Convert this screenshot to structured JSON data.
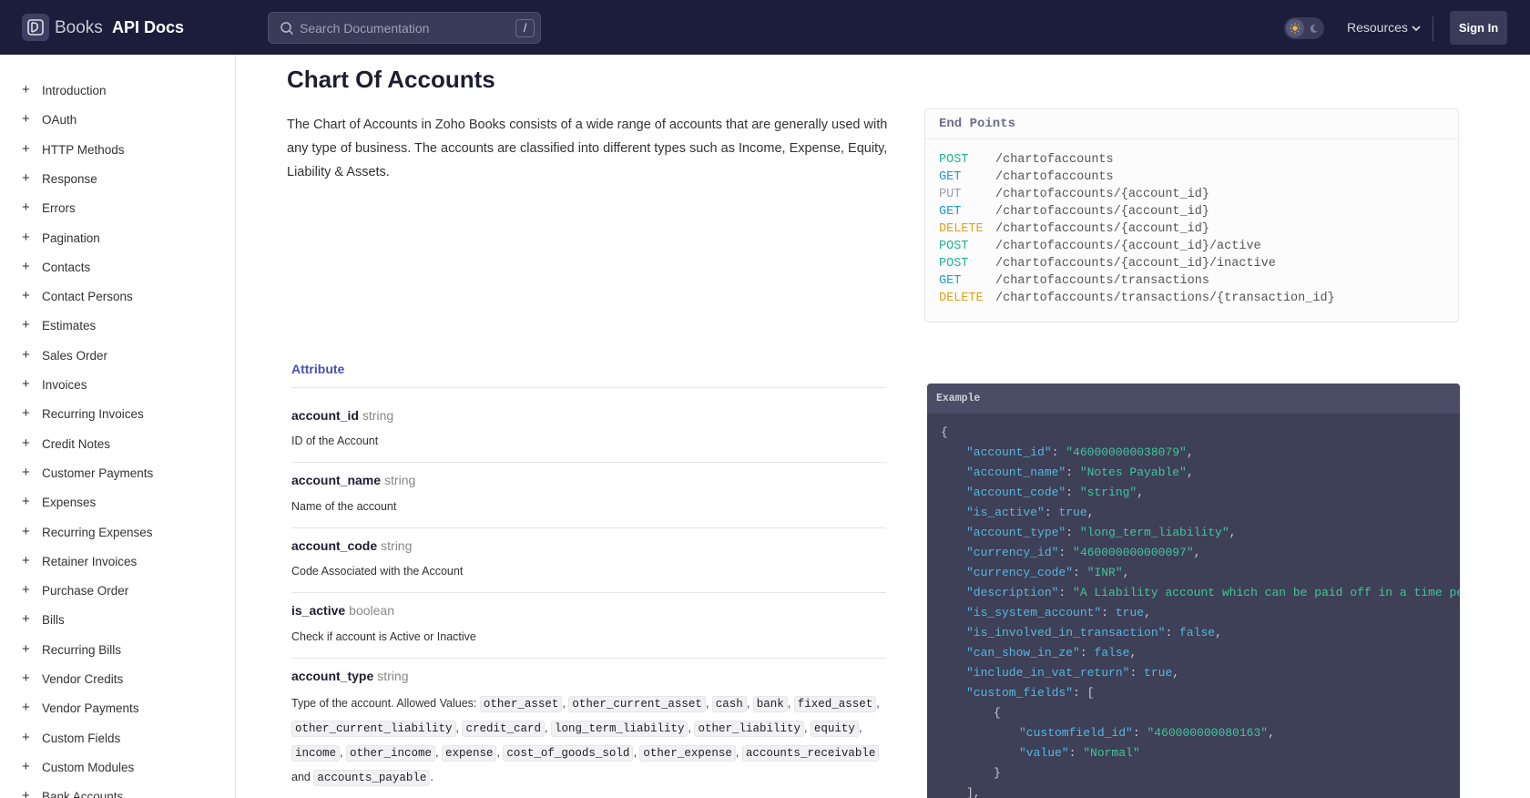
{
  "header": {
    "brand_name": "Books",
    "product_name": "API Docs",
    "search_placeholder": "Search Documentation",
    "search_shortcut": "/",
    "resources_label": "Resources",
    "signin_label": "Sign In"
  },
  "sidebar": {
    "items": [
      {
        "label": "Introduction"
      },
      {
        "label": "OAuth"
      },
      {
        "label": "HTTP Methods"
      },
      {
        "label": "Response"
      },
      {
        "label": "Errors"
      },
      {
        "label": "Pagination"
      },
      {
        "label": "Contacts"
      },
      {
        "label": "Contact Persons"
      },
      {
        "label": "Estimates"
      },
      {
        "label": "Sales Order"
      },
      {
        "label": "Invoices"
      },
      {
        "label": "Recurring Invoices"
      },
      {
        "label": "Credit Notes"
      },
      {
        "label": "Customer Payments"
      },
      {
        "label": "Expenses"
      },
      {
        "label": "Recurring Expenses"
      },
      {
        "label": "Retainer Invoices"
      },
      {
        "label": "Purchase Order"
      },
      {
        "label": "Bills"
      },
      {
        "label": "Recurring Bills"
      },
      {
        "label": "Vendor Credits"
      },
      {
        "label": "Vendor Payments"
      },
      {
        "label": "Custom Fields"
      },
      {
        "label": "Custom Modules"
      },
      {
        "label": "Bank Accounts"
      }
    ],
    "expand_symbol": "+"
  },
  "main": {
    "title": "Chart Of Accounts",
    "intro": "The Chart of Accounts in Zoho Books consists of a wide range of accounts that are generally used with any type of business. The accounts are classified into different types such as Income, Expense, Equity, Liability & Assets."
  },
  "endpoints": {
    "title": "End Points",
    "rows": [
      {
        "method": "POST",
        "path": "/chartofaccounts"
      },
      {
        "method": "GET",
        "path": "/chartofaccounts"
      },
      {
        "method": "PUT",
        "path": "/chartofaccounts/{account_id}"
      },
      {
        "method": "GET",
        "path": "/chartofaccounts/{account_id}"
      },
      {
        "method": "DELETE",
        "path": "/chartofaccounts/{account_id}"
      },
      {
        "method": "POST",
        "path": "/chartofaccounts/{account_id}/active"
      },
      {
        "method": "POST",
        "path": "/chartofaccounts/{account_id}/inactive"
      },
      {
        "method": "GET",
        "path": "/chartofaccounts/transactions"
      },
      {
        "method": "DELETE",
        "path": "/chartofaccounts/transactions/{transaction_id}"
      }
    ],
    "colors": {
      "POST": "#1fb58f",
      "GET": "#1e9ad6",
      "PUT": "#9a9cb0",
      "DELETE": "#e0a21b"
    }
  },
  "attributes": {
    "title": "Attribute",
    "items": [
      {
        "name": "account_id",
        "type": "string",
        "desc": "ID of the Account"
      },
      {
        "name": "account_name",
        "type": "string",
        "desc": "Name of the account"
      },
      {
        "name": "account_code",
        "type": "string",
        "desc": "Code Associated with the Account"
      },
      {
        "name": "is_active",
        "type": "boolean",
        "desc": "Check if account is Active or Inactive"
      },
      {
        "name": "account_type",
        "type": "string",
        "desc": "Type of the account. Allowed Values:"
      }
    ],
    "allowed_values": [
      "other_asset",
      "other_current_asset",
      "cash",
      "bank",
      "fixed_asset",
      "other_current_liability",
      "credit_card",
      "long_term_liability",
      "other_liability",
      "equity",
      "income",
      "other_income",
      "expense",
      "cost_of_goods_sold",
      "other_expense",
      "accounts_receivable",
      "accounts_payable"
    ],
    "and_word": "and"
  },
  "example": {
    "title": "Example",
    "open_brace": "{",
    "lines": [
      {
        "key": "\"account_id\"",
        "val": "\"460000000038079\"",
        "kind": "s"
      },
      {
        "key": "\"account_name\"",
        "val": "\"Notes Payable\"",
        "kind": "s"
      },
      {
        "key": "\"account_code\"",
        "val": "\"string\"",
        "kind": "s"
      },
      {
        "key": "\"is_active\"",
        "val": "true",
        "kind": "b"
      },
      {
        "key": "\"account_type\"",
        "val": "\"long_term_liability\"",
        "kind": "s"
      },
      {
        "key": "\"currency_id\"",
        "val": "\"460000000000097\"",
        "kind": "s"
      },
      {
        "key": "\"currency_code\"",
        "val": "\"INR\"",
        "kind": "s"
      },
      {
        "key": "\"description\"",
        "val": "\"A Liability account which can be paid off in a time period",
        "kind": "s"
      },
      {
        "key": "\"is_system_account\"",
        "val": "true",
        "kind": "b"
      },
      {
        "key": "\"is_involved_in_transaction\"",
        "val": "false",
        "kind": "b"
      },
      {
        "key": "\"can_show_in_ze\"",
        "val": "false",
        "kind": "b"
      },
      {
        "key": "\"include_in_vat_return\"",
        "val": "true",
        "kind": "b"
      },
      {
        "key": "\"custom_fields\"",
        "val": "[",
        "kind": "p"
      }
    ],
    "inner_open": "{",
    "inner_lines": [
      {
        "key": "\"customfield_id\"",
        "val": "\"460000000080163\"",
        "kind": "s"
      },
      {
        "key": "\"value\"",
        "val": "\"Normal\"",
        "kind": "s"
      }
    ],
    "inner_close": "}",
    "array_close": "],"
  }
}
